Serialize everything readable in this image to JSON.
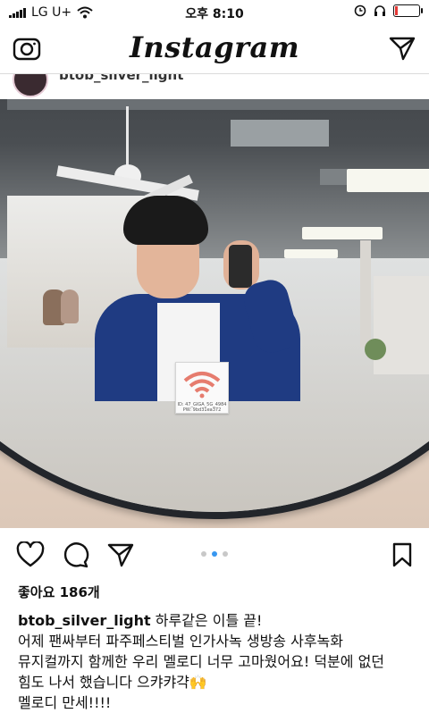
{
  "status_bar": {
    "carrier": "LG U+",
    "time": "오후 8:10"
  },
  "header": {
    "title": "Instagram"
  },
  "post": {
    "username_top": "btob_silver_light",
    "wifi_card_text": "ID: 47_GIGA_5G_4984",
    "wifi_card_pw": "PW: 9bd31ea372",
    "carousel_active_index": 1,
    "carousel_count": 3,
    "likes": "좋아요 186개",
    "caption_username": "btob_silver_light",
    "caption_first": "하루같은 이틀 끝!",
    "caption_lines": [
      "어제 팬싸부터 파주페스티벌 인가사녹 생방송 사후녹화",
      "뮤지컬까지 함께한 우리 멜로디 너무 고마웠어요! 덕분에 없던",
      "힘도 나서 했습니다 으캬캬갹🙌",
      "멜로디 만세!!!!"
    ]
  }
}
